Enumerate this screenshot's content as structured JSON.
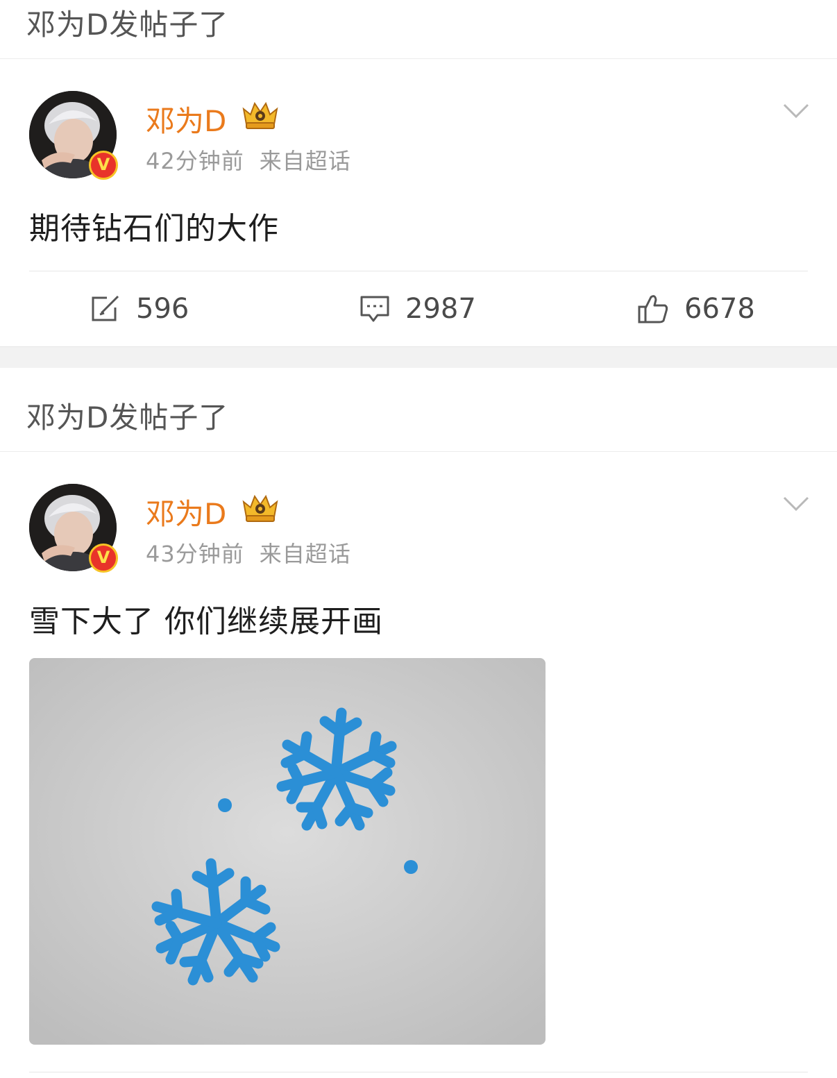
{
  "feed": [
    {
      "header": "邓为D发帖子了",
      "author": {
        "name": "邓为D",
        "avatar_icon": "user-avatar-photo",
        "verified_badge": "V",
        "level_icon": "crown-level-icon"
      },
      "time": "42分钟前",
      "source": "来自超话",
      "text": "期待钻石们的大作",
      "actions": {
        "repost_count": "596",
        "comment_count": "2987",
        "like_count": "6678"
      }
    },
    {
      "header": "邓为D发帖子了",
      "author": {
        "name": "邓为D",
        "avatar_icon": "user-avatar-photo",
        "verified_badge": "V",
        "level_icon": "crown-level-icon"
      },
      "time": "43分钟前",
      "source": "来自超话",
      "text": "雪下大了 你们继续展开画",
      "image": {
        "subject": "snowflake-drawing",
        "stroke_color": "#2b8fd6"
      }
    }
  ],
  "colors": {
    "username": "#ea7a1c",
    "meta": "#9a9a9a",
    "badge_red": "#e8332a",
    "badge_gold": "#f7c325"
  }
}
